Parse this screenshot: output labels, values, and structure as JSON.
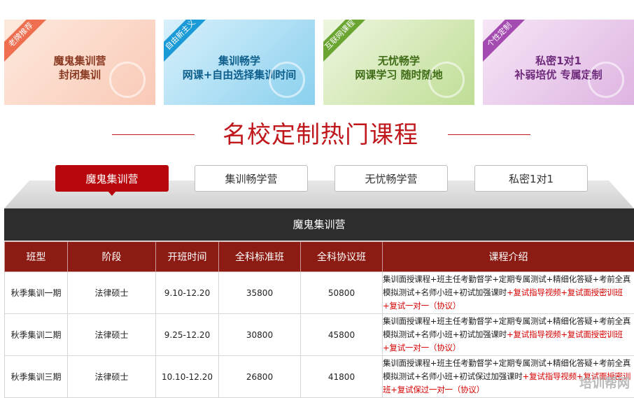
{
  "banners": [
    {
      "tag": "老牌推荐",
      "line1": "魔鬼集训营",
      "line2": "封闭集训"
    },
    {
      "tag": "自由新主义",
      "line1": "集训畅学",
      "line2": "网课+自由选择集训时间"
    },
    {
      "tag": "互联网课程",
      "line1": "无忧畅学",
      "line2": "网课学习 随时随地"
    },
    {
      "tag": "个性定制",
      "line1": "私密1对1",
      "line2": "补弱培优 专属定制"
    }
  ],
  "heading": "名校定制热门课程",
  "tabs": [
    "魔鬼集训营",
    "集训畅学营",
    "无忧畅学营",
    "私密1对1"
  ],
  "active_tab": "魔鬼集训营",
  "section_title": "魔鬼集训营",
  "table": {
    "headers": [
      "班型",
      "阶段",
      "开班时间",
      "全科标准班",
      "全科协议班",
      "课程介绍"
    ],
    "rows": [
      {
        "type": "秋季集训一期",
        "stage": "法律硕士",
        "dates": "9.10-12.20",
        "standard": "35800",
        "agreement": "50800",
        "intro_black": "集训面授课程+班主任考勤督学+定期专属测试+精细化答疑+考前全真模拟测试+名师小班+初试加强课时",
        "intro_red": "+复试指导视频+复试面授密训班+复试一对一（协议）"
      },
      {
        "type": "秋季集训二期",
        "stage": "法律硕士",
        "dates": "9.25-12.20",
        "standard": "30800",
        "agreement": "45800",
        "intro_black": "集训面授课程+班主任考勤督学+定期专属测试+精细化答疑+考前全真模拟测试+名师小班+初试加强课时",
        "intro_red": "+复试指导视频+复试面授密训班+复试一对一（协议）"
      },
      {
        "type": "秋季集训三期",
        "stage": "法律硕士",
        "dates": "10.10-12.20",
        "standard": "26800",
        "agreement": "41800",
        "intro_black": "集训面授课程+班主任考勤督学+定期专属测试+精细化答疑+考前全真模拟测试+名师小班+初试保过加强课时",
        "intro_red": "+复试指导视频+复试面授密训班+复试保过一对一（协议）"
      }
    ]
  },
  "watermark": "培训帮网",
  "colors": {
    "brand_red": "#c0171c",
    "header_bg": "#8c1c13",
    "section_bg": "#2d2d2d"
  }
}
